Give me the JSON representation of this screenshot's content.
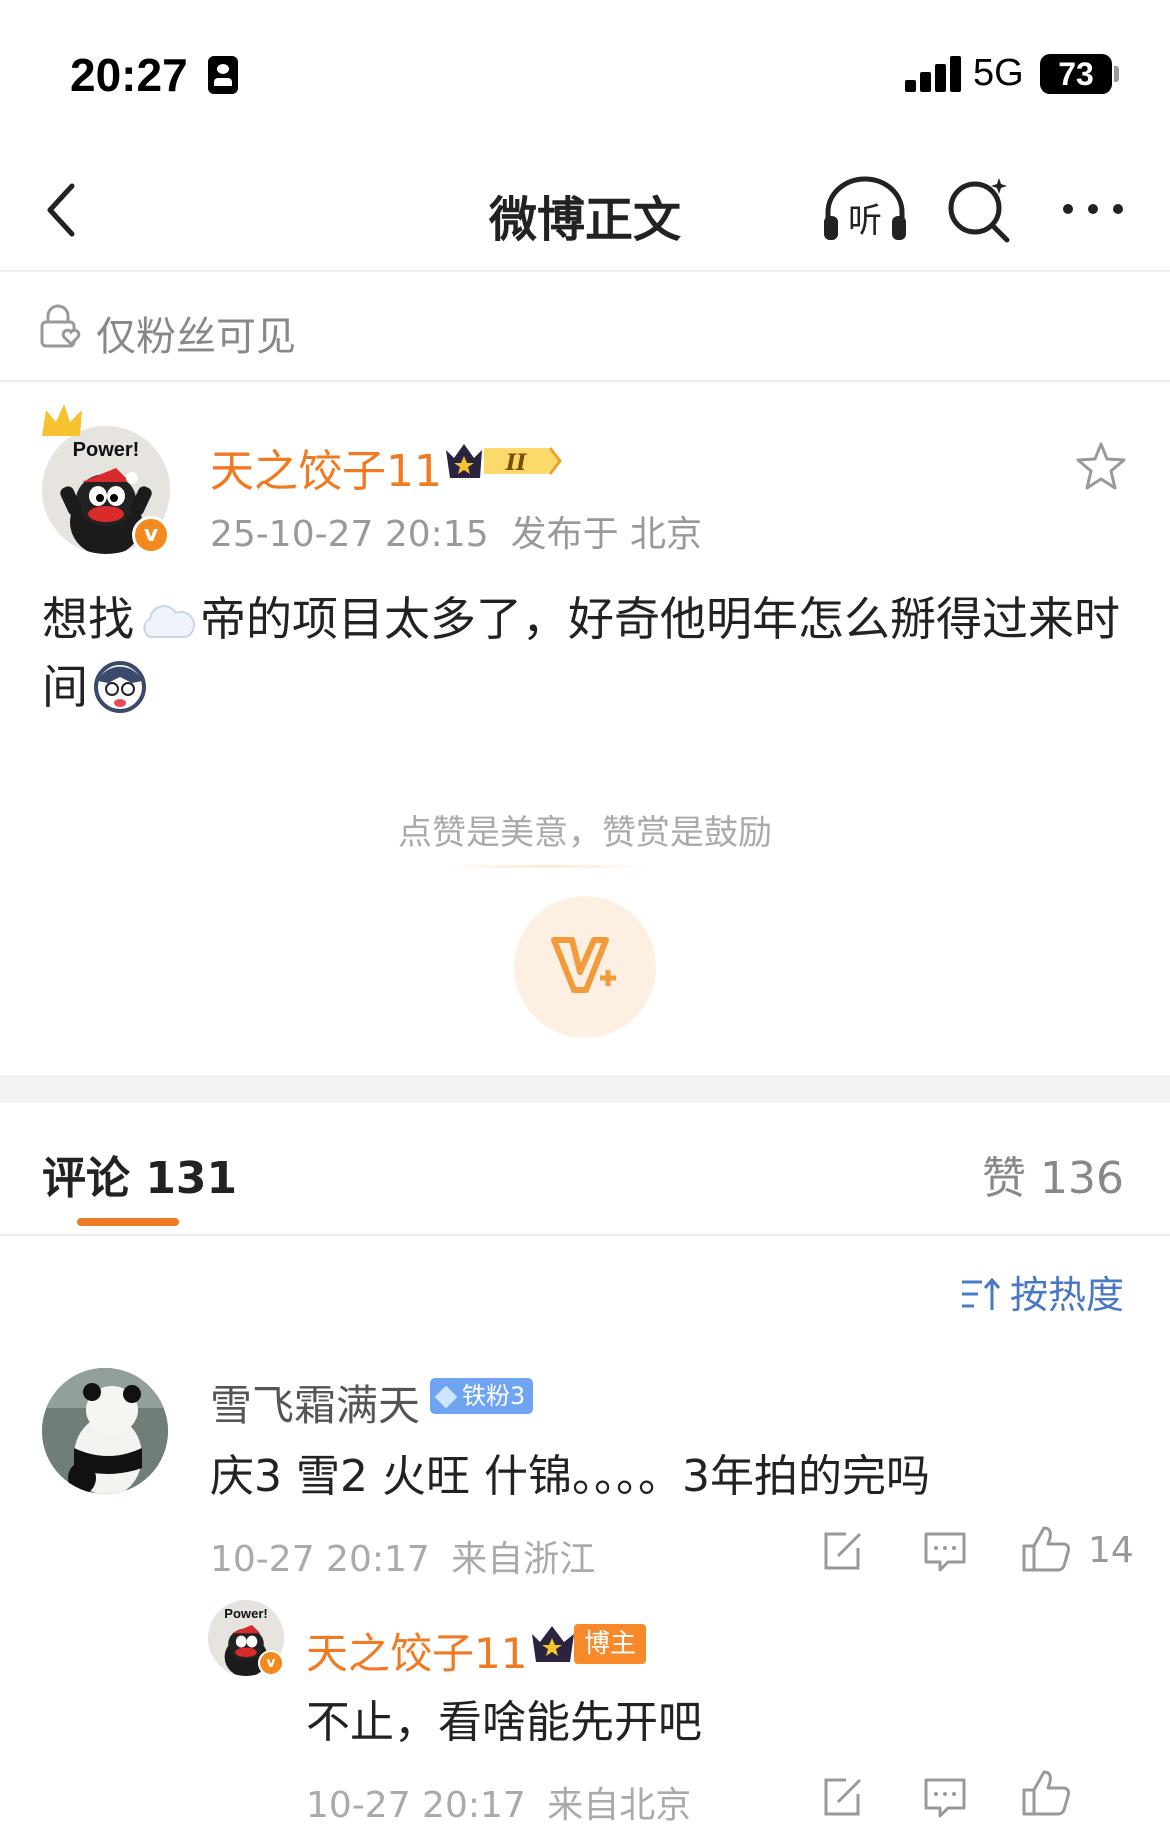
{
  "status_bar": {
    "time": "20:27",
    "network": "5G",
    "battery": "73"
  },
  "nav": {
    "title": "微博正文",
    "listen_label": "听"
  },
  "visibility": {
    "label": "仅粉丝可见"
  },
  "post": {
    "author": "天之饺子11",
    "author_badge": "II",
    "avatar_text": "Power!",
    "verified": "v",
    "time": "25-10-27 20:15",
    "location": "发布于 北京",
    "text_part1": "想找",
    "text_part2": "帝的项目太多了，好奇他明年怎么掰得过来时间"
  },
  "reward": {
    "text": "点赞是美意，赞赏是鼓励"
  },
  "tabs": {
    "comments": "评论 131",
    "likes": "赞 136",
    "sort": "按热度"
  },
  "comments": [
    {
      "user": "雪飞霜满天",
      "badge": "铁粉3",
      "text": "庆3 雪2 火旺 什锦。。。。3年拍的完吗",
      "time": "10-27 20:17",
      "location": "来自浙江",
      "likes": "14",
      "reply": {
        "user": "天之饺子11",
        "tag": "博主",
        "avatar_text": "Power!",
        "text": "不止，看啥能先开吧",
        "time": "10-27 20:17",
        "location": "来自北京"
      }
    }
  ],
  "colors": {
    "accent": "#f07a22",
    "link": "#4a78c2",
    "fan_badge": "#6ea4f2"
  }
}
